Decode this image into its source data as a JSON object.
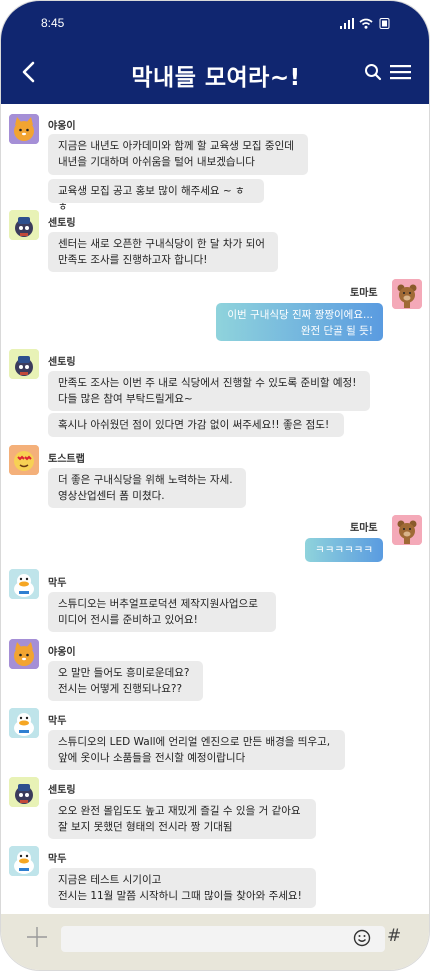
{
  "status_bar": {
    "time": "8:45"
  },
  "header": {
    "title": "막내들 모여라~!"
  },
  "colors": {
    "header_bg": "#102670",
    "bubble_other": "#ebebeb",
    "bubble_mine_start": "#8fd3dc",
    "bubble_mine_end": "#5a9be0",
    "composer_bg": "#e8e6da"
  },
  "messages": [
    {
      "sender": "야옹이",
      "avatar": "cat-avatar",
      "bubbles": [
        "지금은 내년도 아카데미와 함께 할 교육생 모집 중인데\n내년을 기대하며 아쉬움을 털어 내보겠습니다",
        "교육생 모집 공고 홍보 많이 해주세요 ~ ㅎㅎ"
      ]
    },
    {
      "sender": "센토링",
      "avatar": "sentoring-avatar",
      "bubbles": [
        "센터는 새로 오픈한 구내식당이 한 달 차가 되어\n만족도 조사를 진행하고자 합니다!"
      ]
    },
    {
      "sender": "토마토",
      "avatar": "bear-avatar",
      "mine": true,
      "bubbles": [
        "이번 구내식당 진짜 짱짱이에요...\n완전 단골 될 듯!"
      ]
    },
    {
      "sender": "센토링",
      "avatar": "sentoring-avatar",
      "bubbles": [
        "만족도 조사는 이번 주 내로 식당에서 진행할 수 있도록 준비할 예정!\n다들 많은 참여 부탁드릴게요~",
        "혹시나 아쉬웠던 점이 있다면 가감 없이 써주세요!! 좋은 점도!"
      ]
    },
    {
      "sender": "토스트랩",
      "avatar": "toast-avatar",
      "bubbles": [
        "더 좋은 구내식당을 위해 노력하는 자세.\n영상산업센터 폼 미쳤다."
      ]
    },
    {
      "sender": "토마토",
      "avatar": "bear-avatar",
      "mine": true,
      "bubbles": [
        "ㅋㅋㅋㅋㅋㅋ"
      ]
    },
    {
      "sender": "막두",
      "avatar": "duck-avatar",
      "bubbles": [
        "스튜디오는 버추얼프로덕션 제작지원사업으로\n미디어 전시를 준비하고 있어요!"
      ]
    },
    {
      "sender": "야옹이",
      "avatar": "cat-avatar",
      "bubbles": [
        "오 말만 들어도 흥미로운데요?\n전시는 어떻게 진행되나요??"
      ]
    },
    {
      "sender": "막두",
      "avatar": "duck-avatar",
      "bubbles": [
        "스튜디오의 LED Wall에 언리얼 엔진으로 만든 배경을 띄우고,\n앞에 옷이나 소품들을 전시할 예정이랍니다"
      ]
    },
    {
      "sender": "센토링",
      "avatar": "sentoring-avatar",
      "bubbles": [
        "오오 완전 몰입도도 높고 재밌게 즐길 수 있을 거 같아요\n잘 보지 못했던 형태의 전시라 짱 기대됨"
      ]
    },
    {
      "sender": "막두",
      "avatar": "duck-avatar",
      "bubbles": [
        "지금은 테스트 시기이고\n전시는 11월 말쯤 시작하니 그때 많이들 찾아와 주세요!"
      ]
    }
  ],
  "composer": {
    "placeholder": "",
    "hash_label": "#"
  }
}
